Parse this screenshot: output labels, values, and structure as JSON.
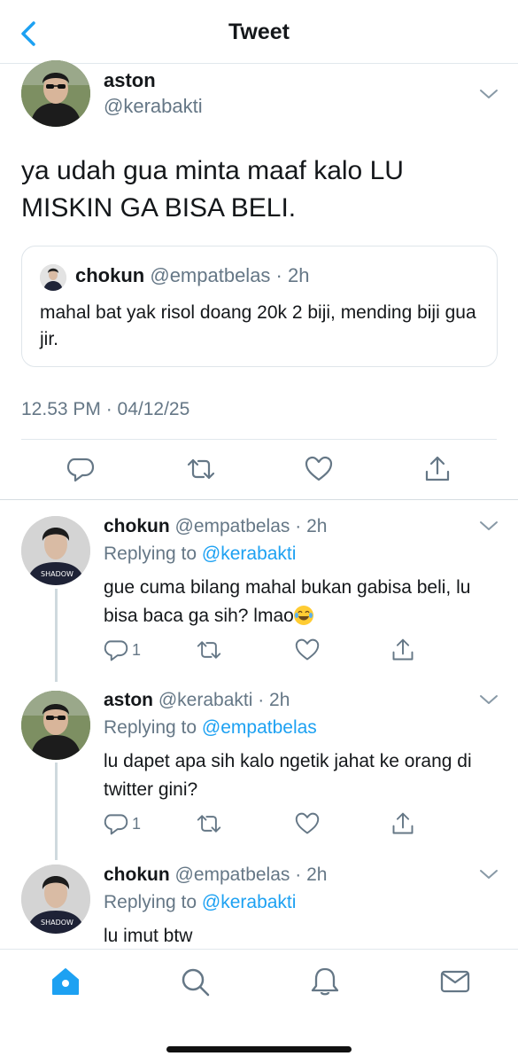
{
  "header": {
    "title": "Tweet",
    "back_icon": "chevron-left-icon"
  },
  "main_tweet": {
    "name": "aston",
    "handle": "@kerabakti",
    "text": "ya udah gua minta maaf kalo LU MISKIN GA BISA BELI.",
    "quote": {
      "name": "chokun",
      "meta": "@empatbelas · 2h",
      "text": "mahal bat yak risol doang 20k 2 biji, mending biji gua jir."
    },
    "timestamp": "12.53 PM · 04/12/25",
    "actions": [
      "reply-icon",
      "retweet-icon",
      "like-icon",
      "share-icon"
    ]
  },
  "replies": [
    {
      "name": "chokun",
      "meta": "@empatbelas · 2h",
      "replying_prefix": "Replying to ",
      "replying_to": "@kerabakti",
      "text": "gue cuma bilang mahal bukan gabisa beli, lu bisa baca ga sih? lmao",
      "emoji": "face-with-tears-of-joy",
      "reply_count": "1"
    },
    {
      "name": "aston",
      "meta": "@kerabakti · 2h",
      "replying_prefix": "Replying to ",
      "replying_to": "@empatbelas",
      "text": "lu dapet apa sih kalo ngetik jahat ke orang di twitter gini?",
      "reply_count": "1"
    },
    {
      "name": "chokun",
      "meta": "@empatbelas · 2h",
      "replying_prefix": "Replying to ",
      "replying_to": "@kerabakti",
      "text": "lu imut btw"
    }
  ],
  "tabbar": {
    "items": [
      "home-icon",
      "search-icon",
      "notifications-icon",
      "messages-icon"
    ],
    "active": "home-icon"
  },
  "colors": {
    "accent": "#1da1f2",
    "secondary_text": "#657786",
    "primary_text": "#14171a",
    "divider": "#e1e8ed"
  }
}
